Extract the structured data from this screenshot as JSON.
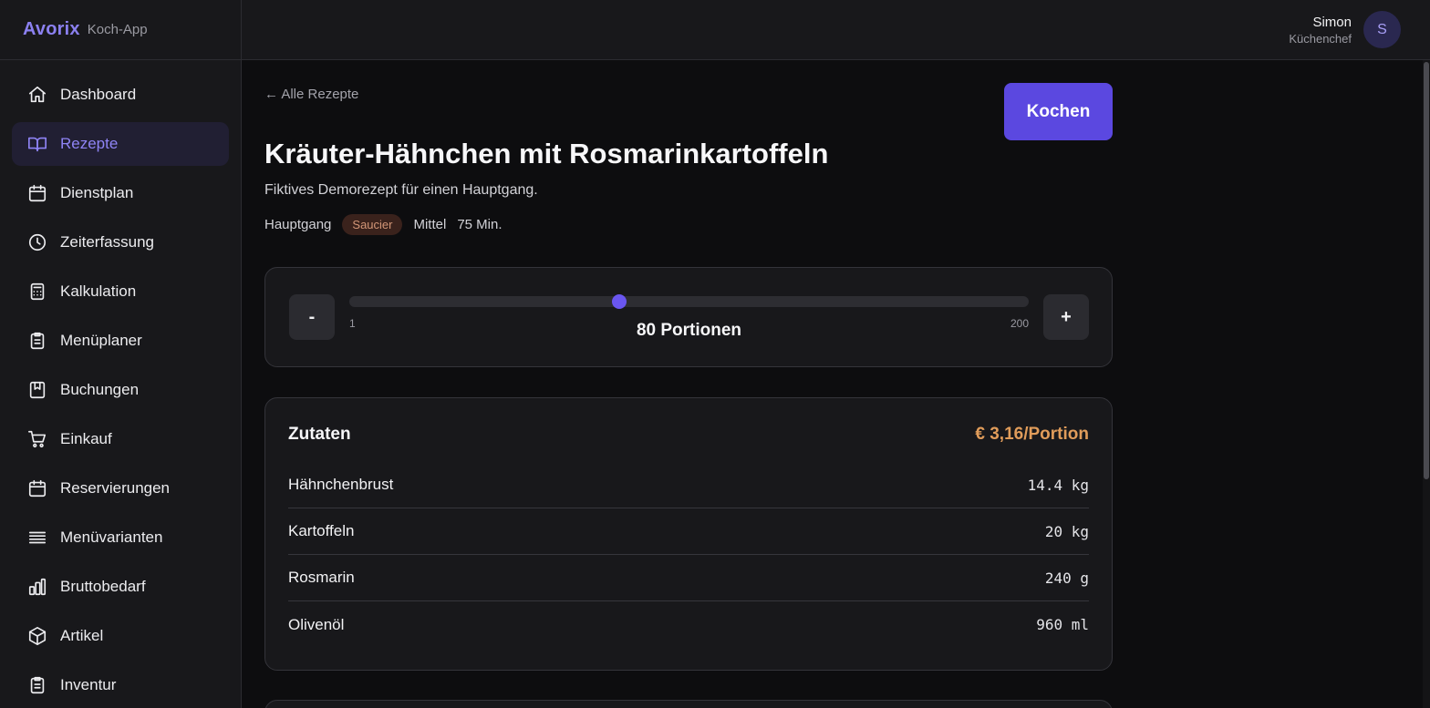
{
  "brand": {
    "name": "Avorix",
    "subtitle": "Koch-App"
  },
  "sidebar": {
    "items": [
      {
        "label": "Dashboard",
        "icon": "home-icon",
        "active": false
      },
      {
        "label": "Rezepte",
        "icon": "book-icon",
        "active": true
      },
      {
        "label": "Dienstplan",
        "icon": "calendar-icon",
        "active": false
      },
      {
        "label": "Zeiterfassung",
        "icon": "clock-icon",
        "active": false
      },
      {
        "label": "Kalkulation",
        "icon": "calculator-icon",
        "active": false
      },
      {
        "label": "Menüplaner",
        "icon": "clipboard-list-icon",
        "active": false
      },
      {
        "label": "Buchungen",
        "icon": "bookmark-book-icon",
        "active": false
      },
      {
        "label": "Einkauf",
        "icon": "shopping-cart-icon",
        "active": false
      },
      {
        "label": "Reservierungen",
        "icon": "calendar-icon",
        "active": false
      },
      {
        "label": "Menüvarianten",
        "icon": "list-icon",
        "active": false
      },
      {
        "label": "Bruttobedarf",
        "icon": "bar-chart-icon",
        "active": false
      },
      {
        "label": "Artikel",
        "icon": "package-icon",
        "active": false
      },
      {
        "label": "Inventur",
        "icon": "clipboard-list-icon",
        "active": false
      }
    ]
  },
  "header": {
    "user_name": "Simon",
    "user_role": "Küchenchef",
    "avatar_initial": "S"
  },
  "recipe": {
    "back_label": "← Alle Rezepte",
    "cook_label": "Kochen",
    "title": "Kräuter-Hähnchen mit Rosmarinkartoffeln",
    "description": "Fiktives Demorezept für einen Hauptgang.",
    "course": "Hauptgang",
    "station": "Saucier",
    "difficulty": "Mittel",
    "duration": "75 Min."
  },
  "portions": {
    "minus_label": "-",
    "plus_label": "+",
    "min": 1,
    "max": 200,
    "min_label": "1",
    "max_label": "200",
    "value": 80,
    "label": "80 Portionen"
  },
  "ingredients": {
    "title": "Zutaten",
    "cost": "€ 3,16/Portion",
    "items": [
      {
        "name": "Hähnchenbrust",
        "qty": "14.4 kg"
      },
      {
        "name": "Kartoffeln",
        "qty": "20 kg"
      },
      {
        "name": "Rosmarin",
        "qty": "240 g"
      },
      {
        "name": "Olivenöl",
        "qty": "960 ml"
      }
    ]
  },
  "colors": {
    "accent": "#5b48e0",
    "brand": "#8b80f0",
    "cost": "#e09c5a",
    "badge_text": "#d39677"
  }
}
